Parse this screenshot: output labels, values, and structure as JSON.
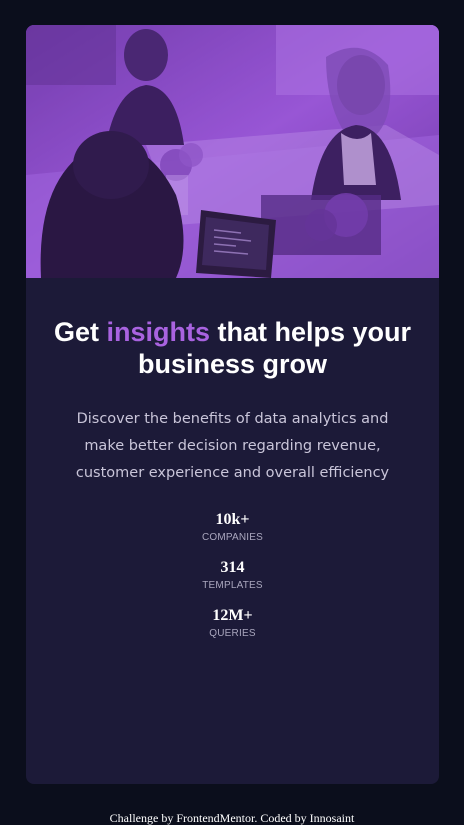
{
  "hero": {
    "image_alt": "Team members working together at a desk",
    "overlay_color": "#8f4ed1"
  },
  "headline": {
    "before": "Get ",
    "accent": "insights",
    "after": " that helps your business grow",
    "accent_color": "#a963e0"
  },
  "description": "Discover the benefits of data analytics and make better decision regarding revenue, customer experience and overall efficiency",
  "stats": [
    {
      "value": "10k+",
      "label": "COMPANIES"
    },
    {
      "value": "314",
      "label": "TEMPLATES"
    },
    {
      "value": "12M+",
      "label": "QUERIES"
    }
  ],
  "footer": {
    "text": "Challenge by FrontendMentor. Coded by Innosaint"
  },
  "colors": {
    "page_bg": "#0b0e1c",
    "card_bg": "#1c1a38",
    "accent": "#a963e0"
  }
}
